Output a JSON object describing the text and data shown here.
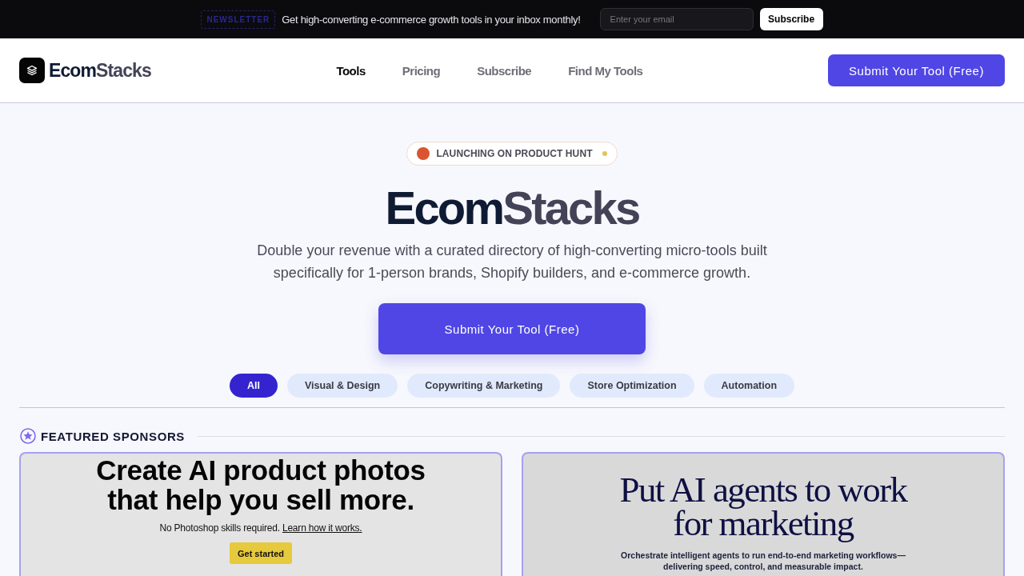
{
  "newsletter_bar": {
    "badge": "NEWSLETTER",
    "message": "Get high-converting e-commerce growth tools in your inbox monthly!",
    "email_field": {
      "placeholder": "Enter your email"
    },
    "button": "Subscribe"
  },
  "navbar": {
    "logo": [
      {
        "text": "Ecom",
        "muted": false
      },
      {
        "text": "Stacks",
        "muted": true
      }
    ],
    "links": [
      {
        "label": "Tools",
        "selected": true
      },
      {
        "label": "Pricing",
        "selected": false
      },
      {
        "label": "Subscribe",
        "selected": false
      },
      {
        "label": "Find My Tools",
        "selected": false
      }
    ],
    "cta": "Submit Your Tool (Free)"
  },
  "hero": {
    "badge": {
      "label": "LAUNCHING ON PRODUCT HUNT"
    },
    "title": [
      {
        "text": "Ecom",
        "muted": false
      },
      {
        "text": "Stacks",
        "muted": true
      }
    ],
    "subtitle": "Double your revenue with a curated directory of high-converting micro-tools built specifically for 1-person brands, Shopify builders, and e-commerce growth.",
    "cta": "Submit Your Tool (Free)"
  },
  "filters": [
    {
      "label": "All",
      "selected": true
    },
    {
      "label": "Visual & Design",
      "selected": false
    },
    {
      "label": "Copywriting & Marketing",
      "selected": false
    },
    {
      "label": "Store Optimization",
      "selected": false
    },
    {
      "label": "Automation",
      "selected": false
    }
  ],
  "featured_sponsors": {
    "heading": "FEATURED SPONSORS",
    "cards": [
      {
        "kind": "photo_ad",
        "headline": [
          "Create AI product photos",
          "that help you sell more."
        ],
        "body": "No Photoshop skills required.",
        "link": "Learn how it works.",
        "button": "Get started"
      },
      {
        "kind": "agents_ad",
        "headline": [
          "Put AI agents to work",
          "for marketing"
        ],
        "body": [
          "Orchestrate intelligent agents to run end-to-end marketing workflows—",
          "delivering speed, control, and measurable impact."
        ]
      }
    ]
  }
}
